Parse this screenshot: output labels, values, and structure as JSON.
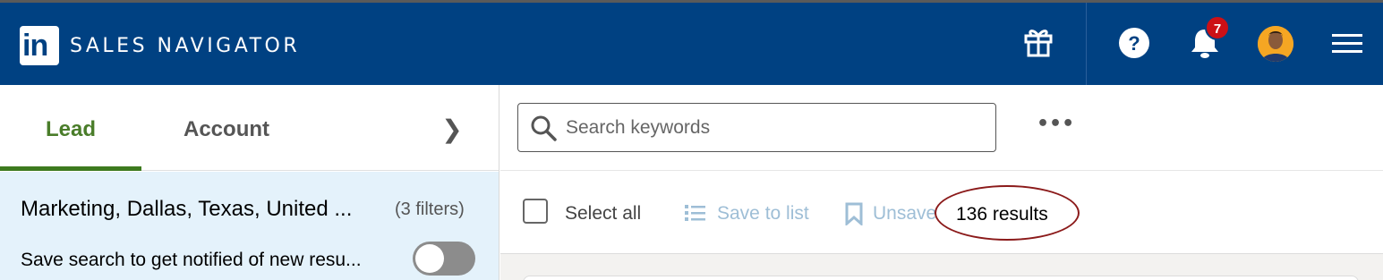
{
  "header": {
    "logo_text": "in",
    "brand": "SALES NAVIGATOR",
    "notification_count": "7",
    "icons": [
      "gift-icon",
      "help-icon",
      "bell-icon",
      "avatar",
      "hamburger-menu-icon"
    ],
    "colors": {
      "bar": "#004182",
      "badge": "#cc1016"
    }
  },
  "left_panel": {
    "tabs": [
      {
        "label": "Lead",
        "active": true
      },
      {
        "label": "Account",
        "active": false
      }
    ],
    "next_glyph": "❯",
    "saved_search": {
      "title": "Marketing, Dallas, Texas, United ...",
      "filter_count": "(3 filters)",
      "notify_text": "Save search to get notified of new resu...",
      "toggle_on": false
    }
  },
  "main": {
    "search": {
      "placeholder": "Search keywords",
      "value": ""
    },
    "more_glyph": "•••",
    "actions": {
      "select_all": "Select all",
      "save_to_list": "Save to list",
      "unsave": "Unsave",
      "results": "136 results"
    }
  }
}
